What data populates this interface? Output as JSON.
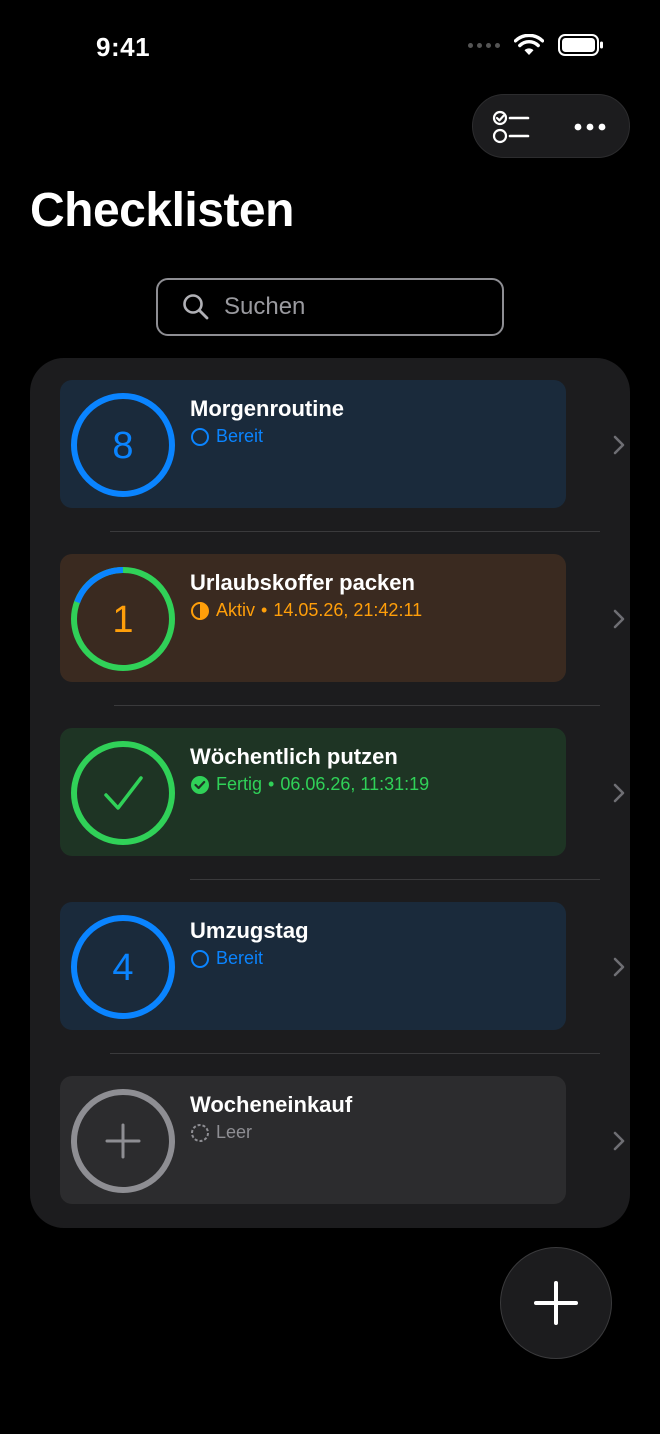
{
  "status_bar": {
    "time": "9:41",
    "icons": [
      "signal-dots-icon",
      "wifi-icon",
      "battery-icon"
    ]
  },
  "toolbar": {
    "left_icon": "checklist-icon",
    "right_icon": "more-icon"
  },
  "header": {
    "title": "Checklisten"
  },
  "search": {
    "placeholder": "Suchen",
    "icon": "search-icon"
  },
  "colors": {
    "blue": "#0a84ff",
    "orange": "#ff9f0a",
    "green": "#30d158",
    "gray": "#8e8e93",
    "blue_bg": "#1a2a3b",
    "orange_bg": "#3a2a20",
    "green_bg": "#1e3424",
    "gray_bg": "#2c2c2e"
  },
  "lists": [
    {
      "title": "Morgenroutine",
      "badge": "8",
      "status": "Bereit",
      "timestamp": "",
      "state": "ready",
      "ring_progress": 0
    },
    {
      "title": "Urlaubskoffer packen",
      "badge": "1",
      "status": "Aktiv",
      "timestamp": "14.05.26, 21:42:11",
      "state": "active",
      "ring_progress": 0.87
    },
    {
      "title": "Wöchentlich putzen",
      "badge": "",
      "status": "Fertig",
      "timestamp": "06.06.26, 11:31:19",
      "state": "done",
      "ring_progress": 1
    },
    {
      "title": "Umzugstag",
      "badge": "4",
      "status": "Bereit",
      "timestamp": "",
      "state": "ready",
      "ring_progress": 0
    },
    {
      "title": "Wocheneinkauf",
      "badge": "",
      "status": "Leer",
      "timestamp": "",
      "state": "empty",
      "ring_progress": 0
    }
  ],
  "fab": {
    "icon": "plus-icon"
  }
}
